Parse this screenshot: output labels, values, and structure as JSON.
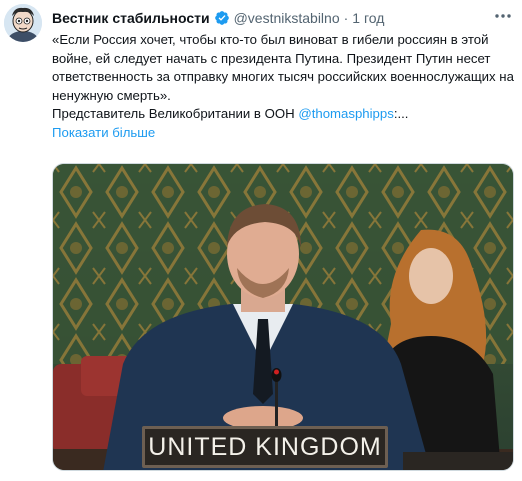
{
  "tweet": {
    "display_name": "Вестник стабильности",
    "handle": "@vestnikstabilno",
    "separator": "·",
    "time": "1 год",
    "body_line1": "«Если Россия хочет, чтобы кто-то был виноват в гибели россиян в этой войне, ей следует начать с президента Путина. Президент Путин несет ответственность за отправку многих тысяч российских военнослужащих на ненужную смерть».",
    "body_line2_prefix": "Представитель Великобритании в ООН ",
    "mention": "@thomasphipps",
    "body_line2_suffix": ":...",
    "show_more": "Показати більше"
  },
  "media": {
    "nameplate": "UNITED KINGDOM"
  },
  "icons": {
    "verified": "verified-badge-icon",
    "more": "more-options-icon",
    "avatar": "profile-avatar"
  },
  "colors": {
    "link": "#1d9bf0",
    "secondary_text": "#536471",
    "primary_text": "#0f1419"
  }
}
